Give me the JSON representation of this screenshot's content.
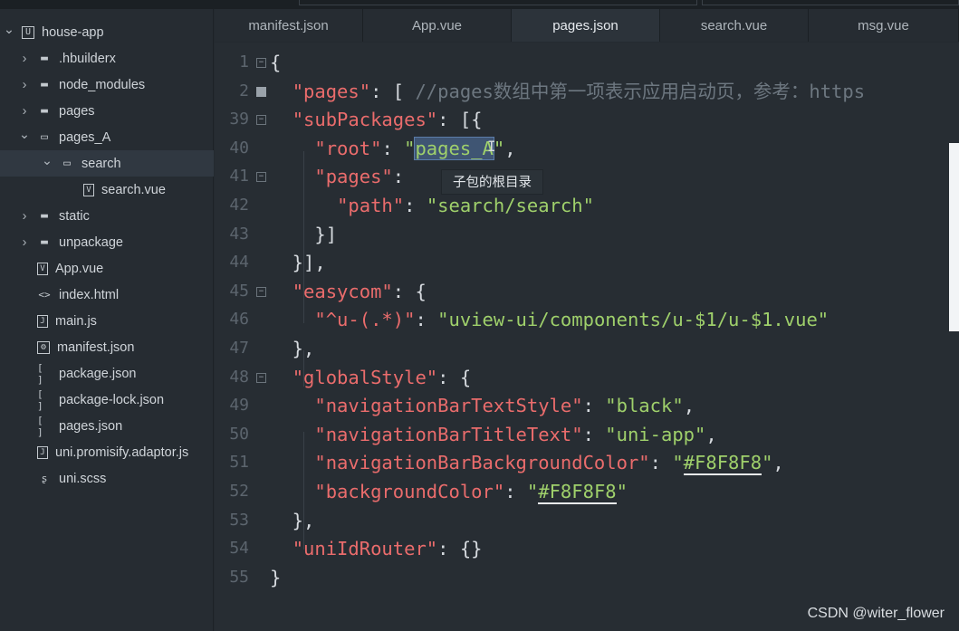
{
  "sidebar": {
    "items": [
      {
        "label": "house-app",
        "icon": "project-icon",
        "icon_glyph": "U",
        "chevron": "down",
        "level": 0
      },
      {
        "label": ".hbuilderx",
        "icon": "folder-icon",
        "icon_glyph": "▬",
        "chevron": "right",
        "level": 1
      },
      {
        "label": "node_modules",
        "icon": "folder-icon",
        "icon_glyph": "▬",
        "chevron": "right",
        "level": 1
      },
      {
        "label": "pages",
        "icon": "folder-icon",
        "icon_glyph": "▬",
        "chevron": "right",
        "level": 1
      },
      {
        "label": "pages_A",
        "icon": "folder-open-icon",
        "icon_glyph": "▭",
        "chevron": "down",
        "level": 1
      },
      {
        "label": "search",
        "icon": "folder-open-icon",
        "icon_glyph": "▭",
        "chevron": "down",
        "level": 2,
        "selected": true
      },
      {
        "label": "search.vue",
        "icon": "vue-file-icon",
        "icon_glyph": "V",
        "chevron": "",
        "level": 3
      },
      {
        "label": "static",
        "icon": "folder-icon",
        "icon_glyph": "▬",
        "chevron": "right",
        "level": 1
      },
      {
        "label": "unpackage",
        "icon": "folder-icon",
        "icon_glyph": "▬",
        "chevron": "right",
        "level": 1
      },
      {
        "label": "App.vue",
        "icon": "vue-file-icon",
        "icon_glyph": "V",
        "chevron": "",
        "level": 1
      },
      {
        "label": "index.html",
        "icon": "html-file-icon",
        "icon_glyph": "<>",
        "chevron": "",
        "level": 1
      },
      {
        "label": "main.js",
        "icon": "js-file-icon",
        "icon_glyph": "J",
        "chevron": "",
        "level": 1
      },
      {
        "label": "manifest.json",
        "icon": "manifest-file-icon",
        "icon_glyph": "⚙",
        "chevron": "",
        "level": 1
      },
      {
        "label": "package.json",
        "icon": "json-file-icon",
        "icon_glyph": "[ ]",
        "chevron": "",
        "level": 1
      },
      {
        "label": "package-lock.json",
        "icon": "json-file-icon",
        "icon_glyph": "[ ]",
        "chevron": "",
        "level": 1
      },
      {
        "label": "pages.json",
        "icon": "json-file-icon",
        "icon_glyph": "[ ]",
        "chevron": "",
        "level": 1
      },
      {
        "label": "uni.promisify.adaptor.js",
        "icon": "js-file-icon",
        "icon_glyph": "J",
        "chevron": "",
        "level": 1
      },
      {
        "label": "uni.scss",
        "icon": "scss-file-icon",
        "icon_glyph": "ʂ",
        "chevron": "",
        "level": 1
      }
    ]
  },
  "tabs": [
    {
      "label": "manifest.json",
      "active": false
    },
    {
      "label": "App.vue",
      "active": false
    },
    {
      "label": "pages.json",
      "active": true
    },
    {
      "label": "search.vue",
      "active": false
    },
    {
      "label": "msg.vue",
      "active": false
    }
  ],
  "editor": {
    "lines": [
      {
        "num": "1",
        "fold": "minus",
        "tokens": [
          [
            "p",
            "{"
          ]
        ]
      },
      {
        "num": "2",
        "fold": "plus",
        "tokens": [
          [
            "p",
            "  "
          ],
          [
            "k",
            "\"pages\""
          ],
          [
            "p",
            ": [ "
          ],
          [
            "c",
            "//pages数组中第一项表示应用启动页，参考：https"
          ]
        ]
      },
      {
        "num": "39",
        "fold": "minus",
        "tokens": [
          [
            "p",
            "  "
          ],
          [
            "k",
            "\"subPackages\""
          ],
          [
            "p",
            ": [{"
          ]
        ]
      },
      {
        "num": "40",
        "fold": "",
        "tokens": [
          [
            "p",
            "    "
          ],
          [
            "k",
            "\"root\""
          ],
          [
            "p",
            ": "
          ],
          [
            "s",
            "\""
          ],
          [
            "sel",
            "pages_A"
          ],
          [
            "s",
            "\""
          ],
          [
            "p",
            ","
          ]
        ]
      },
      {
        "num": "41",
        "fold": "minus",
        "tokens": [
          [
            "p",
            "    "
          ],
          [
            "k",
            "\"pages\""
          ],
          [
            "p",
            ": "
          ]
        ]
      },
      {
        "num": "42",
        "fold": "",
        "tokens": [
          [
            "p",
            "      "
          ],
          [
            "k",
            "\"path\""
          ],
          [
            "p",
            ": "
          ],
          [
            "s",
            "\"search/search\""
          ]
        ]
      },
      {
        "num": "43",
        "fold": "",
        "tokens": [
          [
            "p",
            "    }]"
          ]
        ]
      },
      {
        "num": "44",
        "fold": "",
        "tokens": [
          [
            "p",
            "  }],"
          ]
        ]
      },
      {
        "num": "45",
        "fold": "minus",
        "tokens": [
          [
            "p",
            "  "
          ],
          [
            "k",
            "\"easycom\""
          ],
          [
            "p",
            ": {"
          ]
        ]
      },
      {
        "num": "46",
        "fold": "",
        "tokens": [
          [
            "p",
            "    "
          ],
          [
            "k",
            "\"^u-(.*)\""
          ],
          [
            "p",
            ": "
          ],
          [
            "s",
            "\"uview-ui/components/u-$1/u-$1.vue\""
          ]
        ]
      },
      {
        "num": "47",
        "fold": "",
        "tokens": [
          [
            "p",
            "  },"
          ]
        ]
      },
      {
        "num": "48",
        "fold": "minus",
        "tokens": [
          [
            "p",
            "  "
          ],
          [
            "k",
            "\"globalStyle\""
          ],
          [
            "p",
            ": {"
          ]
        ]
      },
      {
        "num": "49",
        "fold": "",
        "tokens": [
          [
            "p",
            "    "
          ],
          [
            "k",
            "\"navigationBarTextStyle\""
          ],
          [
            "p",
            ": "
          ],
          [
            "s",
            "\"black\""
          ],
          [
            "p",
            ","
          ]
        ]
      },
      {
        "num": "50",
        "fold": "",
        "tokens": [
          [
            "p",
            "    "
          ],
          [
            "k",
            "\"navigationBarTitleText\""
          ],
          [
            "p",
            ": "
          ],
          [
            "s",
            "\"uni-app\""
          ],
          [
            "p",
            ","
          ]
        ]
      },
      {
        "num": "51",
        "fold": "",
        "tokens": [
          [
            "p",
            "    "
          ],
          [
            "k",
            "\"navigationBarBackgroundColor\""
          ],
          [
            "p",
            ": "
          ],
          [
            "s",
            "\""
          ],
          [
            "ul",
            "#F8F8F8"
          ],
          [
            "s",
            "\""
          ],
          [
            "p",
            ","
          ]
        ]
      },
      {
        "num": "52",
        "fold": "",
        "tokens": [
          [
            "p",
            "    "
          ],
          [
            "k",
            "\"backgroundColor\""
          ],
          [
            "p",
            ": "
          ],
          [
            "s",
            "\""
          ],
          [
            "ul",
            "#F8F8F8"
          ],
          [
            "s",
            "\""
          ]
        ]
      },
      {
        "num": "53",
        "fold": "",
        "tokens": [
          [
            "p",
            "  },"
          ]
        ]
      },
      {
        "num": "54",
        "fold": "",
        "tokens": [
          [
            "p",
            "  "
          ],
          [
            "k",
            "\"uniIdRouter\""
          ],
          [
            "p",
            ": {}"
          ]
        ]
      },
      {
        "num": "55",
        "fold": "",
        "tokens": [
          [
            "p",
            "}"
          ]
        ]
      }
    ],
    "tooltip": "子包的根目录"
  },
  "watermark": "CSDN @witer_flower",
  "colors": {
    "key": "#ea6c6c",
    "string": "#9fd06b",
    "comment": "#6d7780",
    "punct": "#d6dadf",
    "selection": "#3f5573"
  }
}
